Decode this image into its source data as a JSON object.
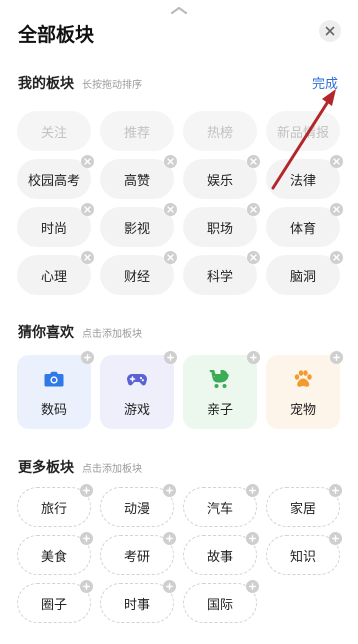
{
  "header": {
    "title": "全部板块"
  },
  "my_sections": {
    "title": "我的板块",
    "hint": "长按拖动排序",
    "done_label": "完成",
    "fixed": [
      "关注",
      "推荐",
      "热榜",
      "新品情报"
    ],
    "items": [
      "校园高考",
      "高赞",
      "娱乐",
      "法律",
      "时尚",
      "影视",
      "职场",
      "体育",
      "心理",
      "财经",
      "科学",
      "脑洞"
    ]
  },
  "guess": {
    "title": "猜你喜欢",
    "hint": "点击添加板块",
    "cards": [
      {
        "label": "数码",
        "icon": "camera-icon",
        "bg": "#eaf1fd",
        "color": "#2f78e8"
      },
      {
        "label": "游戏",
        "icon": "gamepad-icon",
        "bg": "#eeeffa",
        "color": "#5a62d6"
      },
      {
        "label": "亲子",
        "icon": "stroller-icon",
        "bg": "#ecf8ee",
        "color": "#3bab56"
      },
      {
        "label": "宠物",
        "icon": "paw-icon",
        "bg": "#fdf4ea",
        "color": "#f29a2e"
      }
    ]
  },
  "more": {
    "title": "更多板块",
    "hint": "点击添加板块",
    "items": [
      "旅行",
      "动漫",
      "汽车",
      "家居",
      "美食",
      "考研",
      "故事",
      "知识",
      "圈子",
      "时事",
      "国际"
    ]
  },
  "colors": {
    "accent": "#2d6fd8",
    "annotation_arrow": "#b3262b"
  }
}
